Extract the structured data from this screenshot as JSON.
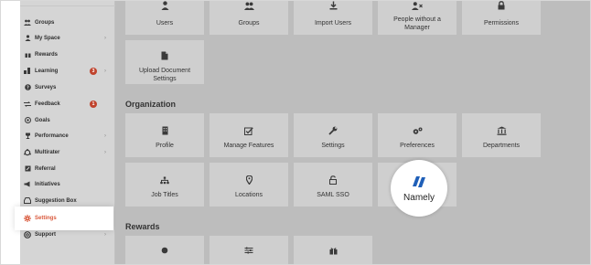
{
  "sidebar": {
    "items": [
      {
        "label": "Groups",
        "icon": "users-icon"
      },
      {
        "label": "My Space",
        "icon": "person-icon",
        "chevron": "›"
      },
      {
        "label": "Rewards",
        "icon": "gift-icon"
      },
      {
        "label": "Learning",
        "icon": "learning-icon",
        "badge": "3",
        "chevron": "›"
      },
      {
        "label": "Surveys",
        "icon": "question-icon"
      },
      {
        "label": "Feedback",
        "icon": "feedback-icon",
        "badge": "1"
      },
      {
        "label": "Goals",
        "icon": "target-icon"
      },
      {
        "label": "Performance",
        "icon": "trophy-icon",
        "chevron": "›"
      },
      {
        "label": "Multirater",
        "icon": "multirater-icon",
        "chevron": "›"
      },
      {
        "label": "Referral",
        "icon": "referral-icon"
      },
      {
        "label": "Initiatives",
        "icon": "megaphone-icon"
      },
      {
        "label": "Suggestion Box",
        "icon": "inbox-icon"
      },
      {
        "label": "Settings",
        "icon": "gear-icon",
        "active": true
      },
      {
        "label": "Support",
        "icon": "lifebuoy-icon",
        "chevron": "›"
      }
    ]
  },
  "top_tiles": [
    {
      "label": "Users",
      "icon": "user-icon"
    },
    {
      "label": "Groups",
      "icon": "users-icon"
    },
    {
      "label": "Import Users",
      "icon": "import-icon"
    },
    {
      "label": "People without a Manager",
      "icon": "user-x-icon"
    },
    {
      "label": "Permissions",
      "icon": "lock-icon"
    }
  ],
  "upload_tile": {
    "label": "Upload Document Settings",
    "icon": "document-icon"
  },
  "organization": {
    "title": "Organization",
    "tiles": [
      {
        "label": "Profile",
        "icon": "building-icon"
      },
      {
        "label": "Manage Features",
        "icon": "checkbox-icon"
      },
      {
        "label": "Settings",
        "icon": "wrench-icon"
      },
      {
        "label": "Preferences",
        "icon": "gears-icon"
      },
      {
        "label": "Departments",
        "icon": "institution-icon"
      },
      {
        "label": "Job Titles",
        "icon": "sitemap-icon"
      },
      {
        "label": "Locations",
        "icon": "map-pin-icon"
      },
      {
        "label": "SAML SSO",
        "icon": "unlock-icon"
      }
    ]
  },
  "namely": {
    "label": "Namely",
    "brand_color": "#1f5fb8"
  },
  "rewards": {
    "title": "Rewards",
    "tiles": [
      {
        "icon": "circle-icon"
      },
      {
        "icon": "sliders-icon"
      },
      {
        "icon": "gift-icon"
      }
    ]
  },
  "colors": {
    "accent": "#d9583b",
    "badge": "#c0432d"
  }
}
